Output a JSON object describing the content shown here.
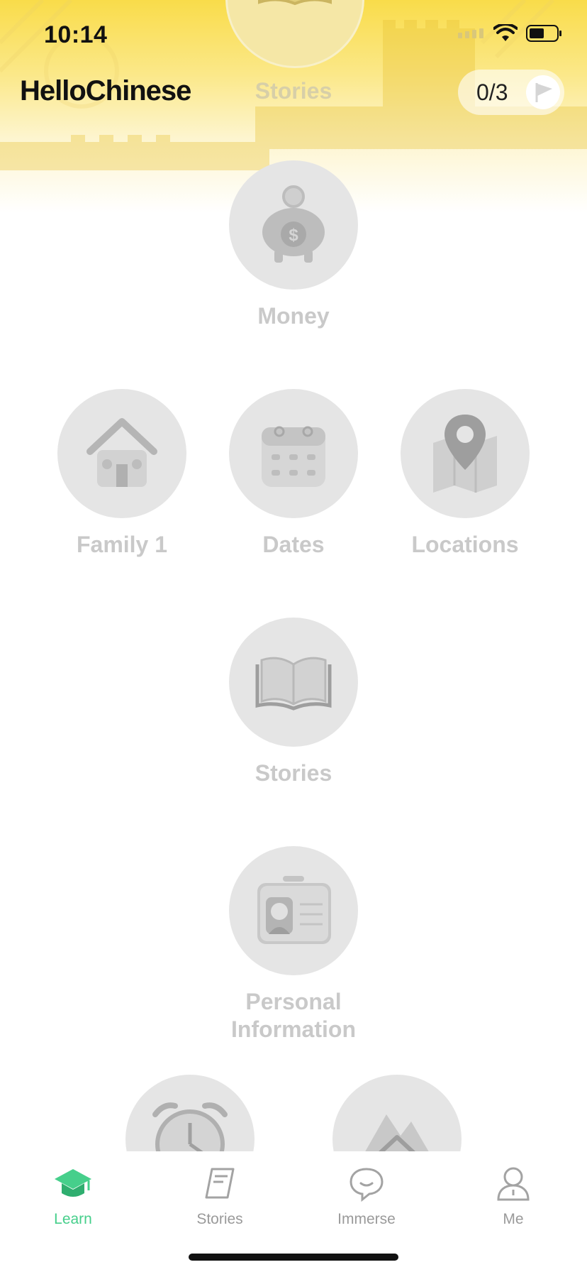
{
  "status_bar": {
    "time": "10:14"
  },
  "header": {
    "logo": "HelloChinese",
    "title": "Stories",
    "progress": "0/3"
  },
  "lessons": {
    "money": {
      "label": "Money",
      "icon": "piggy-bank-icon"
    },
    "family": {
      "label": "Family 1",
      "icon": "house-icon"
    },
    "dates": {
      "label": "Dates",
      "icon": "calendar-icon"
    },
    "locations": {
      "label": "Locations",
      "icon": "map-pin-icon"
    },
    "stories": {
      "label": "Stories",
      "icon": "open-book-icon"
    },
    "personal": {
      "label_line1": "Personal",
      "label_line2": "Information",
      "icon": "id-card-icon"
    },
    "time": {
      "icon": "alarm-clock-icon"
    },
    "places": {
      "icon": "mountain-house-icon"
    }
  },
  "tabs": [
    {
      "label": "Learn",
      "icon": "graduation-cap-icon",
      "active": true
    },
    {
      "label": "Stories",
      "icon": "book-icon",
      "active": false
    },
    {
      "label": "Immerse",
      "icon": "speech-bubble-icon",
      "active": false
    },
    {
      "label": "Me",
      "icon": "person-icon",
      "active": false
    }
  ],
  "colors": {
    "accent": "#46cf8b",
    "header_yellow": "#f9dc4a",
    "locked_circle": "#e5e5e5",
    "locked_text": "#c9c9c9",
    "tab_inactive": "#9a9a9a"
  }
}
